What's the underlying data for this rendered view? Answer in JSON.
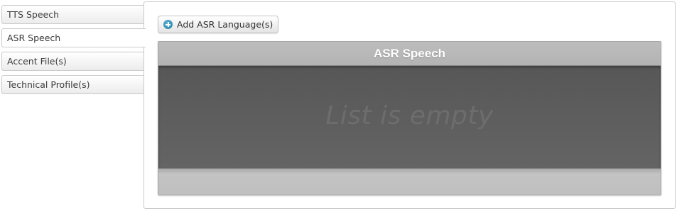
{
  "tabs": [
    {
      "label": "TTS Speech",
      "active": false
    },
    {
      "label": "ASR Speech",
      "active": true
    },
    {
      "label": "Accent File(s)",
      "active": false
    },
    {
      "label": "Technical Profile(s)",
      "active": false
    }
  ],
  "toolbar": {
    "add_label": "Add ASR Language(s)",
    "add_icon": "plus-circle-icon"
  },
  "grid": {
    "title": "ASR Speech",
    "empty_text": "List is empty"
  },
  "colors": {
    "accent": "#1e7fa6",
    "grid_body": "#5c5c5c",
    "grid_header": "#b8b8b8"
  }
}
